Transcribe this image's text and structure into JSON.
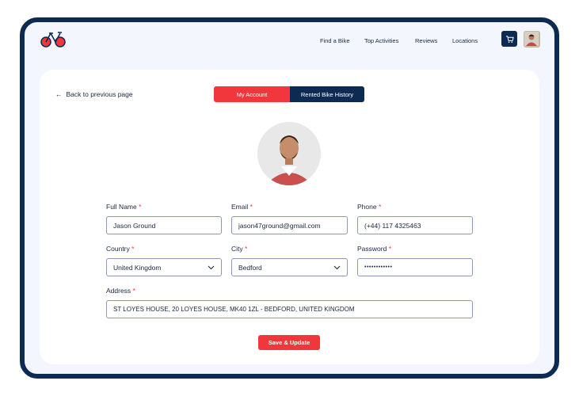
{
  "nav": {
    "items": [
      "Find a Bike",
      "Top Activities",
      "Reviews",
      "Locations"
    ]
  },
  "back_label": "Back to previous page",
  "tabs": [
    "My Account",
    "Rented Bike History"
  ],
  "form": {
    "full_name": {
      "label": "Full Name",
      "value": "Jason Ground"
    },
    "email": {
      "label": "Email",
      "value": "jason47ground@gmail.com"
    },
    "phone": {
      "label": "Phone",
      "value": "(+44) 117 4325463"
    },
    "country": {
      "label": "Country",
      "value": "United Kingdom"
    },
    "city": {
      "label": "City",
      "value": "Bedford"
    },
    "password": {
      "label": "Password",
      "value": "••••••••••••"
    },
    "address": {
      "label": "Address",
      "value": "ST LOYES HOUSE, 20 LOYES HOUSE, MK40 1ZL - BEDFORD, UNITED KINGDOM"
    },
    "required_mark": "*"
  },
  "save_label": "Save & Update",
  "colors": {
    "accent": "#f2373c",
    "navy": "#0d2a52"
  }
}
